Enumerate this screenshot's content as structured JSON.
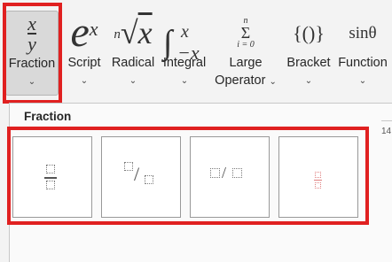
{
  "ribbon": {
    "buttons": [
      {
        "id": "fraction",
        "label": "Fraction",
        "glyph_top": "x",
        "glyph_bottom": "y",
        "has_dropdown": true,
        "selected": true
      },
      {
        "id": "script",
        "label": "Script",
        "glyph_base": "e",
        "glyph_sup": "x",
        "has_dropdown": true
      },
      {
        "id": "radical",
        "label": "Radical",
        "glyph_index": "n",
        "glyph_root": "√",
        "glyph_x": "x",
        "has_dropdown": true
      },
      {
        "id": "integral",
        "label": "Integral",
        "glyph_sign": "∫",
        "glyph_upper": "x",
        "glyph_lower": "−x",
        "has_dropdown": true
      },
      {
        "id": "large-operator",
        "label": "Large",
        "label2": "Operator",
        "glyph_top": "n",
        "glyph_mid": "Σ",
        "glyph_bottom": "i = 0",
        "has_dropdown": true
      },
      {
        "id": "bracket",
        "label": "Bracket",
        "glyph": "{()}",
        "has_dropdown": true
      },
      {
        "id": "function",
        "label": "Function",
        "glyph": "sinθ",
        "has_dropdown": true
      }
    ],
    "chevron": "⌄"
  },
  "gallery": {
    "title": "Fraction",
    "edge_text": "14",
    "items": [
      {
        "id": "stacked-fraction",
        "style": "stacked"
      },
      {
        "id": "skewed-fraction",
        "style": "skewed",
        "slash": "/"
      },
      {
        "id": "linear-fraction",
        "style": "linear",
        "slash": "/"
      },
      {
        "id": "small-fraction",
        "style": "small-stacked"
      }
    ]
  },
  "colors": {
    "highlight": "#e02020",
    "selected_bg": "#d9d9d9",
    "ribbon_bg": "#f3f3f3",
    "gallery_bg": "#fafafa",
    "tile_bg": "#ffffff"
  }
}
